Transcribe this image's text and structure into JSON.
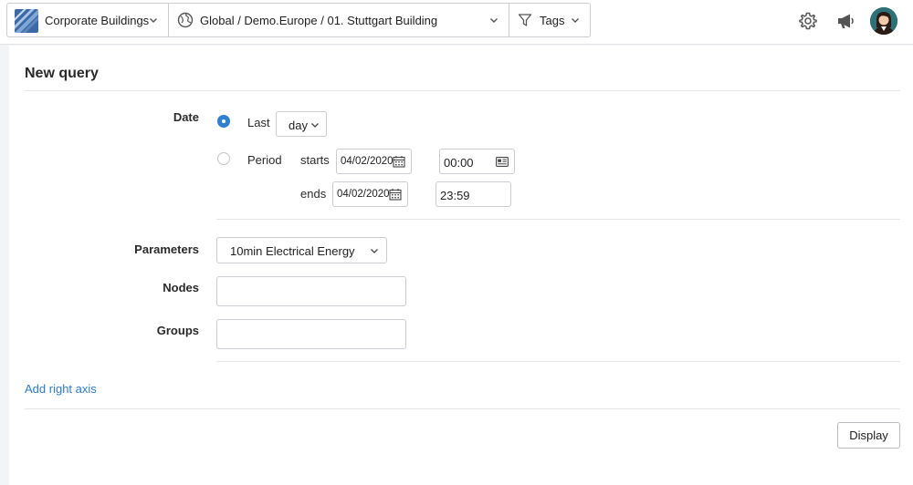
{
  "topbar": {
    "building": {
      "label": "Corporate Buildings",
      "icon": "building-thumbnail-icon"
    },
    "location": {
      "path": "Global / Demo.Europe / 01. Stuttgart Building",
      "icon": "globe-icon"
    },
    "tags": {
      "label": "Tags",
      "icon": "filter-icon"
    },
    "settings_icon": "gear-icon",
    "announce_icon": "megaphone-icon",
    "avatar_icon": "user-avatar"
  },
  "query": {
    "title": "New query",
    "date": {
      "label": "Date",
      "last": {
        "label": "Last",
        "selected": true,
        "unit": "day"
      },
      "period": {
        "label": "Period",
        "selected": false,
        "starts_label": "starts",
        "start_date": "04/02/2020",
        "start_time": "00:00",
        "ends_label": "ends",
        "end_date": "04/02/2020",
        "end_time": "23:59"
      }
    },
    "parameters": {
      "label": "Parameters",
      "value": "10min Electrical Energy"
    },
    "nodes": {
      "label": "Nodes",
      "value": ""
    },
    "groups": {
      "label": "Groups",
      "value": ""
    },
    "add_right_axis": "Add right axis",
    "display_button": "Display"
  },
  "colors": {
    "accent": "#2f80d1",
    "link": "#2e7bc6",
    "border": "#c9ccd1"
  }
}
